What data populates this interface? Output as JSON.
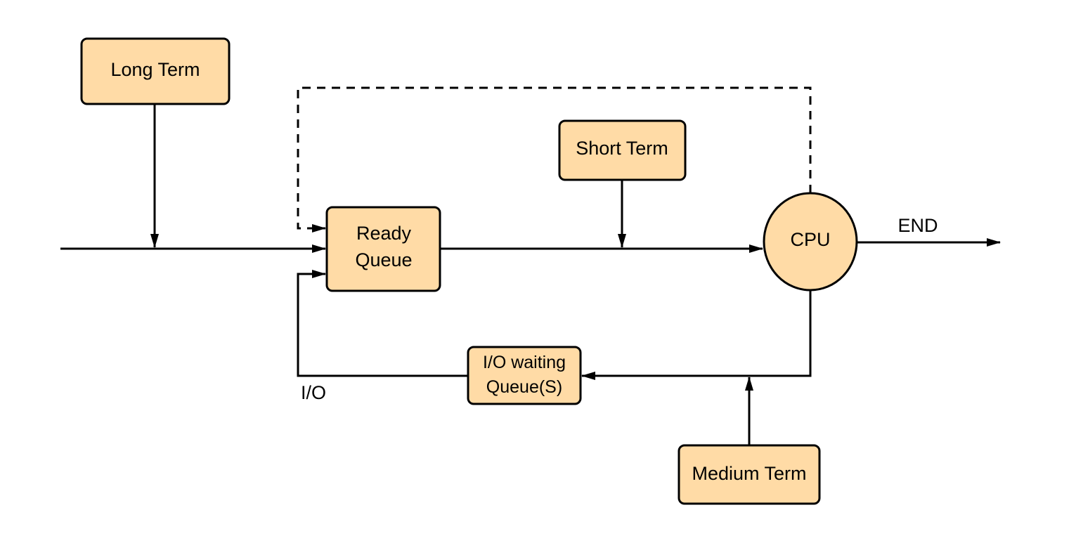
{
  "diagram": {
    "fill_color": "#FFDBA6",
    "line_color": "#000000",
    "nodes": {
      "long_term": "Long Term",
      "short_term": "Short Term",
      "medium_term": "Medium Term",
      "ready_queue": [
        "Ready",
        "Queue"
      ],
      "cpu": "CPU",
      "io_queue": [
        "I/O waiting",
        "Queue(S)"
      ]
    },
    "labels": {
      "end": "END",
      "io": "I/O"
    },
    "edges": [
      {
        "from": "input",
        "to": "ready_queue",
        "style": "solid"
      },
      {
        "from": "long_term",
        "to": "input-line",
        "style": "solid"
      },
      {
        "from": "ready_queue",
        "to": "cpu",
        "style": "solid"
      },
      {
        "from": "short_term",
        "to": "ready-cpu-line",
        "style": "solid"
      },
      {
        "from": "cpu",
        "to": "ready_queue",
        "style": "dashed"
      },
      {
        "from": "cpu",
        "to": "end",
        "style": "solid"
      },
      {
        "from": "cpu",
        "to": "io_queue",
        "style": "solid"
      },
      {
        "from": "medium_term",
        "to": "cpu-io-line",
        "style": "solid"
      },
      {
        "from": "io_queue",
        "to": "ready_queue",
        "style": "solid"
      }
    ]
  }
}
